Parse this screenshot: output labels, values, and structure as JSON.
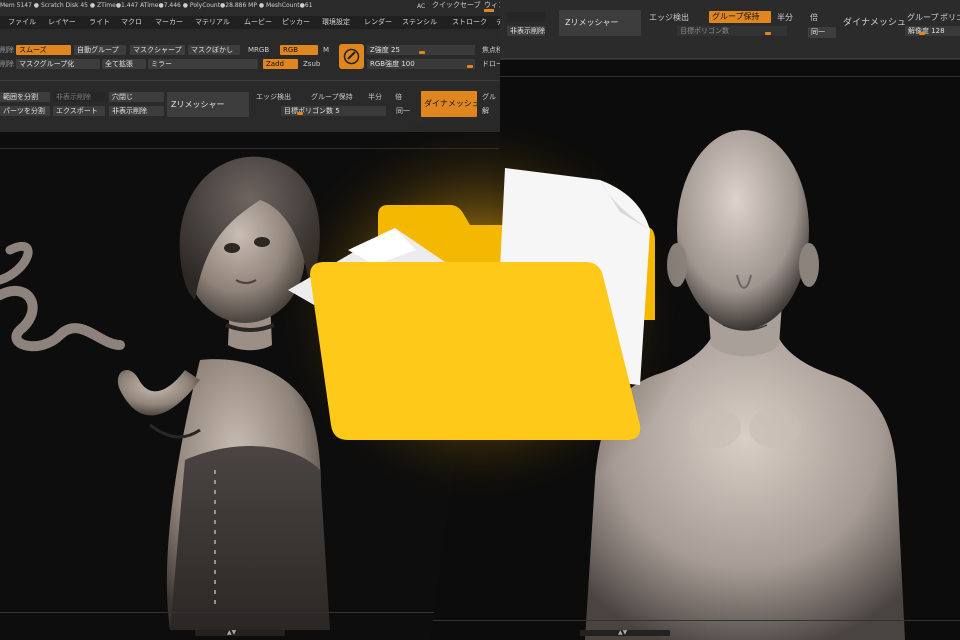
{
  "left_window": {
    "status_bar": "Mem 5147 ● Scratch Disk 45 ● ZTime●1.447 ATime●7.446 ● PolyCount●28.886 MP ● MeshCount●61",
    "status_right": [
      "AC",
      "クイックセーブ",
      "ウィン"
    ],
    "menu": [
      "ファイル",
      "レイヤー",
      "ライト",
      "マクロ",
      "マーカー",
      "マテリアル",
      "ムービー",
      "ピッカー",
      "環境設定",
      "レンダー",
      "ステンシル",
      "ストローク",
      "テ"
    ],
    "row1": {
      "mode_label": "削除",
      "smooth": "スムーズ",
      "autogroup": "自動グループ",
      "mask_sharp": "マスクシャープ",
      "mask_blur": "マスクぼかし",
      "mrgb": "MRGB",
      "rgb": "RGB",
      "m": "M",
      "z_intensity": "Z強度 25",
      "anchor": "焦点移"
    },
    "row2": {
      "mode_label": "削除",
      "mask_group": "マスクグループ化",
      "grow_all": "全て拡張",
      "mirror": "ミラー",
      "zadd": "Zadd",
      "zsub": "Zsub",
      "rgb_intensity": "RGB強度 100",
      "draw": "ドロー"
    },
    "row3": {
      "split_group": "範囲を分割",
      "hidden_delete": "非表示削除",
      "close_holes": "穴閉じ",
      "zremesher": "Zリメッシャー",
      "edge_detect": "エッジ検出",
      "keep_groups": "グループ保持",
      "half": "半分",
      "double": "倍",
      "dynamesh": "ダイナメッシュ",
      "group": "グル"
    },
    "row4": {
      "split_parts": "パーツを分割",
      "export": "エクスポート",
      "delete_hidden": "非表示削除",
      "target_poly": "目標ポリゴン数 5",
      "same": "同一"
    }
  },
  "right_window": {
    "row1": {
      "zremesher": "Zリメッシャー",
      "edge_detect": "エッジ検出",
      "keep_groups": "グループ保持",
      "half": "半分",
      "double": "倍",
      "dynamesh": "ダイナメッシュ",
      "group": "グループ",
      "poly": "ポリゴ"
    },
    "row2": {
      "hidden_delete": "非表示削除",
      "target_poly": "目標ポリゴン数",
      "same": "同一",
      "resolution": "解像度 128"
    }
  },
  "colors": {
    "accent": "#e0861e",
    "folder_front": "#ffc91a",
    "folder_back": "#f5b800",
    "paper": "#f4f4f4"
  },
  "icons": [
    "folder-icon",
    "brush-icon"
  ]
}
